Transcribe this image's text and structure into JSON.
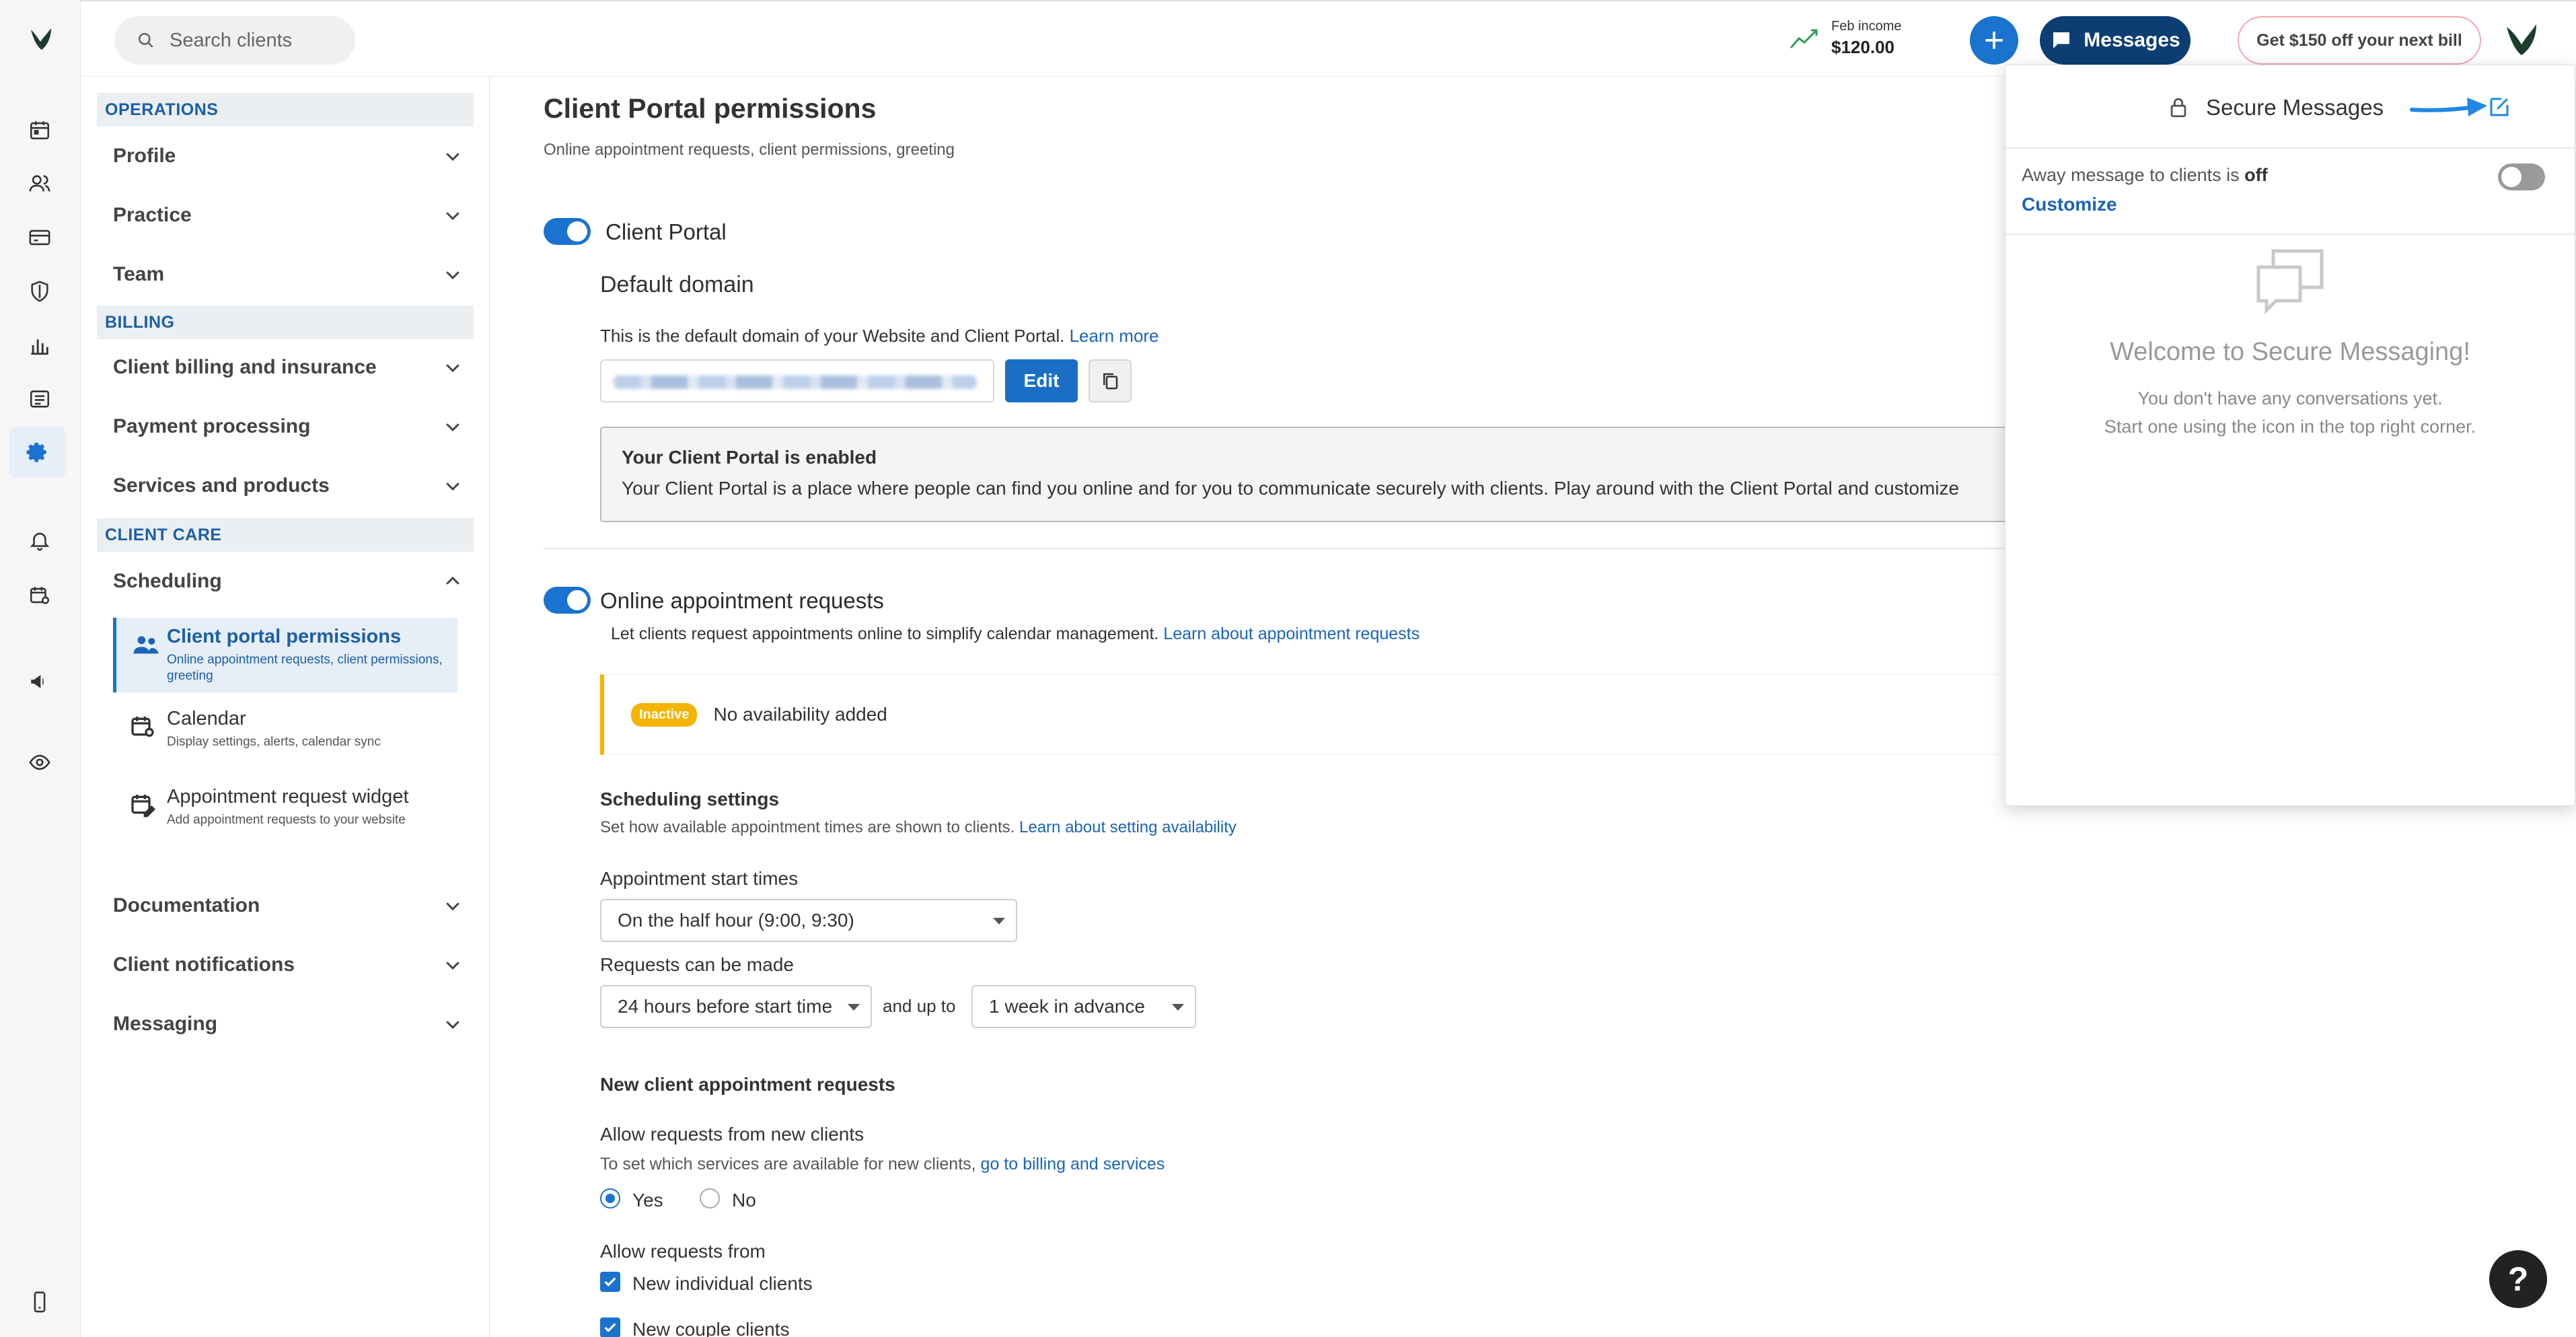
{
  "topbar": {
    "search_placeholder": "Search clients",
    "income_label": "Feb income",
    "income_value": "$120.00",
    "add_label": "+",
    "messages_label": "Messages",
    "promo_label": "Get $150 off your next bill"
  },
  "sidebar": {
    "operations_header": "OPERATIONS",
    "profile": "Profile",
    "practice": "Practice",
    "team": "Team",
    "billing_header": "BILLING",
    "client_billing": "Client billing and insurance",
    "payment_processing": "Payment processing",
    "services_products": "Services and products",
    "client_care_header": "CLIENT CARE",
    "scheduling": "Scheduling",
    "sub_items": [
      {
        "title": "Client portal permissions",
        "desc": "Online appointment requests, client permissions, greeting"
      },
      {
        "title": "Calendar",
        "desc": "Display settings, alerts, calendar sync"
      },
      {
        "title": "Appointment request widget",
        "desc": "Add appointment requests to your website"
      }
    ],
    "documentation": "Documentation",
    "client_notifications": "Client notifications",
    "messaging": "Messaging"
  },
  "main": {
    "title": "Client Portal permissions",
    "subtitle": "Online appointment requests, client permissions, greeting",
    "client_portal_label": "Client Portal",
    "default_domain_title": "Default domain",
    "default_domain_desc": "This is the default domain of your Website and Client Portal.",
    "learn_more": "Learn more",
    "edit_label": "Edit",
    "enabled_title": "Your Client Portal is enabled",
    "enabled_desc": "Your Client Portal is a place where people can find you online and for you to communicate securely with clients. Play around with the Client Portal and customize",
    "online_requests_label": "Online appointment requests",
    "online_requests_desc": "Let clients request appointments online to simplify calendar management.",
    "online_requests_link": "Learn about appointment requests",
    "inactive_badge": "Inactive",
    "no_availability": "No availability added",
    "scheduling_settings_title": "Scheduling settings",
    "scheduling_settings_desc": "Set how available appointment times are shown to clients.",
    "scheduling_settings_link": "Learn about setting availability",
    "start_times_label": "Appointment start times",
    "start_times_value": "On the half hour (9:00, 9:30)",
    "requests_made_label": "Requests can be made",
    "requests_before_value": "24 hours before start time",
    "and_up_to": "and up to",
    "requests_advance_value": "1 week in advance",
    "new_client_title": "New client appointment requests",
    "allow_new_label": "Allow requests from new clients",
    "allow_new_desc": "To set which services are available for new clients,",
    "allow_new_link": "go to billing and services",
    "yes_label": "Yes",
    "no_label": "No",
    "allow_from_label": "Allow requests from",
    "individual_label": "New individual clients",
    "couple_label": "New couple clients"
  },
  "panel": {
    "title": "Secure Messages",
    "away_text_prefix": "Away message to clients is",
    "away_state": "off",
    "customize": "Customize",
    "welcome": "Welcome to Secure Messaging!",
    "line1": "You don't have any conversations yet.",
    "line2": "Start one using the icon in the top right corner."
  },
  "help_label": "?",
  "colors": {
    "accent": "#1a73cf",
    "navy": "#0c3e73",
    "warning": "#f4b400"
  }
}
